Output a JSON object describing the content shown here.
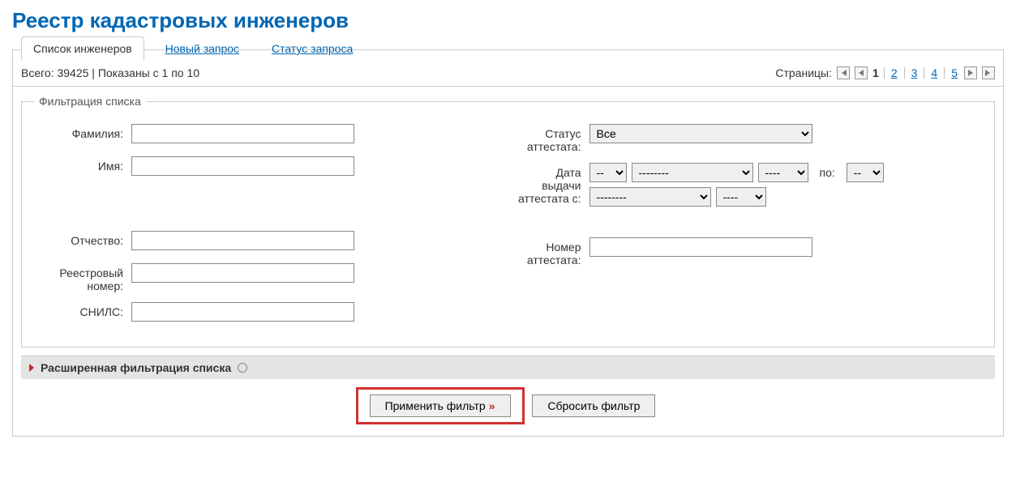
{
  "title": "Реестр кадастровых инженеров",
  "tabs": {
    "list": "Список инженеров",
    "new_request": "Новый запрос",
    "request_status": "Статус запроса"
  },
  "summary": {
    "text": "Всего: 39425 | Показаны с 1 по 10",
    "pages_label": "Страницы:",
    "pages": [
      "1",
      "2",
      "3",
      "4",
      "5"
    ],
    "current_page": "1"
  },
  "filter": {
    "legend": "Фильтрация списка",
    "surname_label": "Фамилия:",
    "name_label": "Имя:",
    "patronymic_label": "Отчество:",
    "reg_num_label": "Реестровый номер:",
    "snils_label": "СНИЛС:",
    "status_label": "Статус аттестата:",
    "status_value": "Все",
    "date_label": "Дата выдачи аттестата с:",
    "date_to_label": "по:",
    "day_value": "--",
    "month_value": "--------",
    "year_value": "----",
    "cert_num_label": "Номер аттестата:"
  },
  "advanced": {
    "label": "Расширенная фильтрация списка"
  },
  "buttons": {
    "apply": "Применить фильтр",
    "apply_suffix": "»",
    "reset": "Сбросить фильтр"
  }
}
